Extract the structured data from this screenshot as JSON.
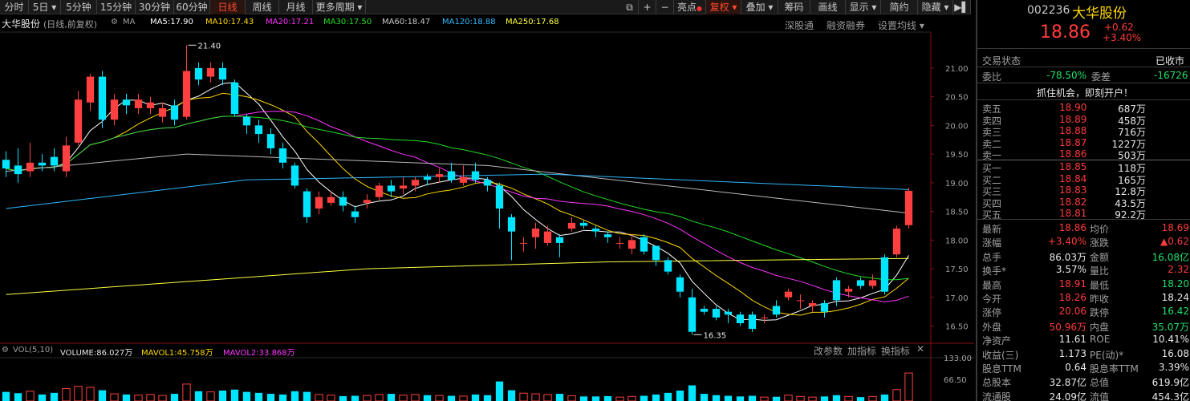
{
  "toolbar": {
    "items": [
      "分时",
      "5日",
      "5分钟",
      "15分钟",
      "30分钟",
      "60分钟",
      "日线",
      "周线",
      "月线",
      "更多周期"
    ],
    "active": "日线",
    "right_items": [
      "亮点",
      "复权",
      "叠加",
      "筹码",
      "画线",
      "显示",
      "简约",
      "隐藏"
    ],
    "nav_prev": "<",
    "nav_next": ">"
  },
  "info": {
    "title": "大华股份",
    "mode": "(日线,前复权)",
    "ma_label": "MA",
    "ma5": "MA5:17.90",
    "ma10": "MA10:17.43",
    "ma20": "MA20:17.21",
    "ma30": "MA30:17.50",
    "ma60": "MA60:18.47",
    "ma120": "MA120:18.88",
    "ma250": "MA250:17.68",
    "links": [
      "深股通",
      "融资融券",
      "设置均线"
    ]
  },
  "chart_annotations": {
    "high": "21.40",
    "low": "16.35"
  },
  "price_axis": [
    "21.00",
    "20.50",
    "20.00",
    "19.50",
    "19.00",
    "18.50",
    "18.00",
    "17.50",
    "17.00",
    "16.50"
  ],
  "volume": {
    "label": "VOL(5,10)",
    "volume": "VOLUME:86.027万",
    "mavol1": "MAVOL1:45.758万",
    "mavol2": "MAVOL2:33.868万",
    "links": [
      "改参数",
      "加指标",
      "换指标"
    ],
    "axis": [
      "133.00",
      "66.50"
    ]
  },
  "colors": {
    "up": "#ff4040",
    "down": "#00e5ff",
    "ma5": "#ffffff",
    "ma10": "#ffd700",
    "ma20": "#ff33ff",
    "ma30": "#22dd22",
    "ma60": "#b8b8b8",
    "ma120": "#2fb8ff",
    "ma250": "#ffff40"
  },
  "quote": {
    "code": "002236",
    "name": "大华股份",
    "price": "18.86",
    "change": "+0.62",
    "pct": "+3.40%",
    "status_label": "交易状态",
    "status_value": "已收市",
    "weibi_label": "委比",
    "weibi_value": "-78.50%",
    "weicha_label": "委差",
    "weicha_value": "-16726",
    "promo": "抓住机会，即刻开户！",
    "sells": [
      {
        "label": "卖五",
        "price": "18.90",
        "vol": "687万"
      },
      {
        "label": "卖四",
        "price": "18.89",
        "vol": "458万"
      },
      {
        "label": "卖三",
        "price": "18.88",
        "vol": "716万"
      },
      {
        "label": "卖二",
        "price": "18.87",
        "vol": "1227万"
      },
      {
        "label": "卖一",
        "price": "18.86",
        "vol": "503万"
      }
    ],
    "buys": [
      {
        "label": "买一",
        "price": "18.85",
        "vol": "118万"
      },
      {
        "label": "买二",
        "price": "18.84",
        "vol": "165万"
      },
      {
        "label": "买三",
        "price": "18.83",
        "vol": "12.8万"
      },
      {
        "label": "买四",
        "price": "18.82",
        "vol": "43.5万"
      },
      {
        "label": "买五",
        "price": "18.81",
        "vol": "92.2万"
      }
    ],
    "stats": [
      {
        "l1": "最新",
        "v1": "18.86",
        "c1": "red",
        "l2": "均价",
        "v2": "18.69",
        "c2": "red"
      },
      {
        "l1": "涨幅",
        "v1": "+3.40%",
        "c1": "red",
        "l2": "涨跌",
        "v2": "▲0.62",
        "c2": "red"
      },
      {
        "l1": "总手",
        "v1": "86.03万",
        "c1": "white",
        "l2": "金额",
        "v2": "16.08亿",
        "c2": "green"
      },
      {
        "l1": "换手*",
        "v1": "3.57%",
        "c1": "white",
        "l2": "量比",
        "v2": "2.32",
        "c2": "red"
      },
      {
        "l1": "最高",
        "v1": "18.91",
        "c1": "red",
        "l2": "最低",
        "v2": "18.20",
        "c2": "green"
      },
      {
        "l1": "今开",
        "v1": "18.26",
        "c1": "red",
        "l2": "昨收",
        "v2": "18.24",
        "c2": "white"
      },
      {
        "l1": "涨停",
        "v1": "20.06",
        "c1": "red",
        "l2": "跌停",
        "v2": "16.42",
        "c2": "green"
      },
      {
        "l1": "外盘",
        "v1": "50.96万",
        "c1": "red",
        "l2": "内盘",
        "v2": "35.07万",
        "c2": "green"
      },
      {
        "l1": "净资产",
        "v1": "11.61",
        "c1": "white",
        "l2": "ROE",
        "v2": "10.41%",
        "c2": "white"
      },
      {
        "l1": "收益(三)",
        "v1": "1.173",
        "c1": "white",
        "l2": "PE(动)*",
        "v2": "16.08",
        "c2": "white"
      },
      {
        "l1": "股息TTM",
        "v1": "0.64",
        "c1": "white",
        "l2": "股息率TTM",
        "v2": "3.39%",
        "c2": "white"
      },
      {
        "l1": "总股本",
        "v1": "32.87亿",
        "c1": "white",
        "l2": "总值",
        "v2": "619.9亿",
        "c2": "white"
      },
      {
        "l1": "流通股",
        "v1": "24.09亿",
        "c1": "white",
        "l2": "流值",
        "v2": "454.3亿",
        "c2": "white"
      }
    ]
  },
  "chart_data": {
    "type": "candlestick",
    "ylim": [
      16.2,
      21.6
    ],
    "candles": [
      [
        19.4,
        19.25,
        19.55,
        19.1
      ],
      [
        19.3,
        19.15,
        19.6,
        19.0
      ],
      [
        19.2,
        19.35,
        19.7,
        19.1
      ],
      [
        19.35,
        19.3,
        19.5,
        19.2
      ],
      [
        19.45,
        19.3,
        19.6,
        19.2
      ],
      [
        19.2,
        19.65,
        19.8,
        19.1
      ],
      [
        19.7,
        20.45,
        20.6,
        19.65
      ],
      [
        20.4,
        20.85,
        20.9,
        20.25
      ],
      [
        20.85,
        20.1,
        20.95,
        19.95
      ],
      [
        20.1,
        20.45,
        20.55,
        20.0
      ],
      [
        20.45,
        20.35,
        20.55,
        20.2
      ],
      [
        20.3,
        20.45,
        20.55,
        20.2
      ],
      [
        20.3,
        20.4,
        20.5,
        20.2
      ],
      [
        20.15,
        20.3,
        20.4,
        20.05
      ],
      [
        20.35,
        20.1,
        20.45,
        20.0
      ],
      [
        20.15,
        20.95,
        21.4,
        20.1
      ],
      [
        21.0,
        20.8,
        21.1,
        20.7
      ],
      [
        20.85,
        21.0,
        21.1,
        20.75
      ],
      [
        21.0,
        20.8,
        21.1,
        20.7
      ],
      [
        20.75,
        20.2,
        20.8,
        20.15
      ],
      [
        20.15,
        20.0,
        20.2,
        19.85
      ],
      [
        20.0,
        19.85,
        20.1,
        19.7
      ],
      [
        19.85,
        19.6,
        19.95,
        19.5
      ],
      [
        19.6,
        19.35,
        19.7,
        19.25
      ],
      [
        19.3,
        18.95,
        19.35,
        18.9
      ],
      [
        18.85,
        18.4,
        18.9,
        18.3
      ],
      [
        18.55,
        18.75,
        18.85,
        18.45
      ],
      [
        18.65,
        18.75,
        18.85,
        18.6
      ],
      [
        18.75,
        18.6,
        18.85,
        18.5
      ],
      [
        18.5,
        18.4,
        18.6,
        18.3
      ],
      [
        18.65,
        18.7,
        18.8,
        18.55
      ],
      [
        18.75,
        18.95,
        19.0,
        18.7
      ],
      [
        18.95,
        18.85,
        19.05,
        18.75
      ],
      [
        18.9,
        18.95,
        19.1,
        18.8
      ],
      [
        18.95,
        19.05,
        19.1,
        18.85
      ],
      [
        19.1,
        19.05,
        19.15,
        18.95
      ],
      [
        19.1,
        19.15,
        19.25,
        19.0
      ],
      [
        19.2,
        19.05,
        19.35,
        19.0
      ],
      [
        19.0,
        19.1,
        19.3,
        18.95
      ],
      [
        19.2,
        19.05,
        19.35,
        19.0
      ],
      [
        19.05,
        18.95,
        19.1,
        18.85
      ],
      [
        18.95,
        18.55,
        19.0,
        18.2
      ],
      [
        18.4,
        18.15,
        18.45,
        17.65
      ],
      [
        17.95,
        17.95,
        18.05,
        17.8
      ],
      [
        18.05,
        18.2,
        18.3,
        17.85
      ],
      [
        17.95,
        18.15,
        18.25,
        17.9
      ],
      [
        18.05,
        17.95,
        18.1,
        17.7
      ],
      [
        18.2,
        18.3,
        18.4,
        18.15
      ],
      [
        18.3,
        18.25,
        18.35,
        18.2
      ],
      [
        18.2,
        18.15,
        18.25,
        18.05
      ],
      [
        18.1,
        18.05,
        18.15,
        17.95
      ],
      [
        17.95,
        17.95,
        18.05,
        17.85
      ],
      [
        17.85,
        18.0,
        18.1,
        17.75
      ],
      [
        18.05,
        17.8,
        18.1,
        17.75
      ],
      [
        17.9,
        17.65,
        17.9,
        17.55
      ],
      [
        17.65,
        17.45,
        17.7,
        17.4
      ],
      [
        17.35,
        17.1,
        17.4,
        17.0
      ],
      [
        17.0,
        16.4,
        17.15,
        16.35
      ],
      [
        16.8,
        16.75,
        16.85,
        16.7
      ],
      [
        16.8,
        16.65,
        16.85,
        16.6
      ],
      [
        16.75,
        16.7,
        16.8,
        16.55
      ],
      [
        16.7,
        16.55,
        16.75,
        16.5
      ],
      [
        16.7,
        16.45,
        16.75,
        16.4
      ],
      [
        16.65,
        16.65,
        16.7,
        16.55
      ],
      [
        16.85,
        16.7,
        16.95,
        16.65
      ],
      [
        17.0,
        17.1,
        17.15,
        16.95
      ],
      [
        16.95,
        16.95,
        17.05,
        16.8
      ],
      [
        16.85,
        16.9,
        16.95,
        16.75
      ],
      [
        16.9,
        16.75,
        16.95,
        16.65
      ],
      [
        17.3,
        16.95,
        17.35,
        16.85
      ],
      [
        17.1,
        17.15,
        17.2,
        17.0
      ],
      [
        17.3,
        17.2,
        17.35,
        17.15
      ],
      [
        17.2,
        17.3,
        17.4,
        17.15
      ],
      [
        17.7,
        17.1,
        17.75,
        17.05
      ],
      [
        17.75,
        18.2,
        18.25,
        17.7
      ],
      [
        18.26,
        18.86,
        18.91,
        18.2
      ]
    ],
    "volumes": [
      28,
      24,
      30,
      20,
      25,
      38,
      45,
      42,
      33,
      22,
      20,
      18,
      20,
      17,
      22,
      52,
      30,
      28,
      32,
      35,
      28,
      25,
      22,
      20,
      30,
      28,
      20,
      18,
      15,
      16,
      17,
      20,
      22,
      18,
      20,
      18,
      17,
      16,
      15,
      20,
      18,
      60,
      33,
      24,
      22,
      20,
      22,
      16,
      14,
      14,
      15,
      12,
      14,
      16,
      20,
      25,
      32,
      48,
      22,
      18,
      16,
      14,
      16,
      12,
      13,
      18,
      14,
      12,
      14,
      18,
      14,
      12,
      14,
      20,
      35,
      86
    ]
  }
}
